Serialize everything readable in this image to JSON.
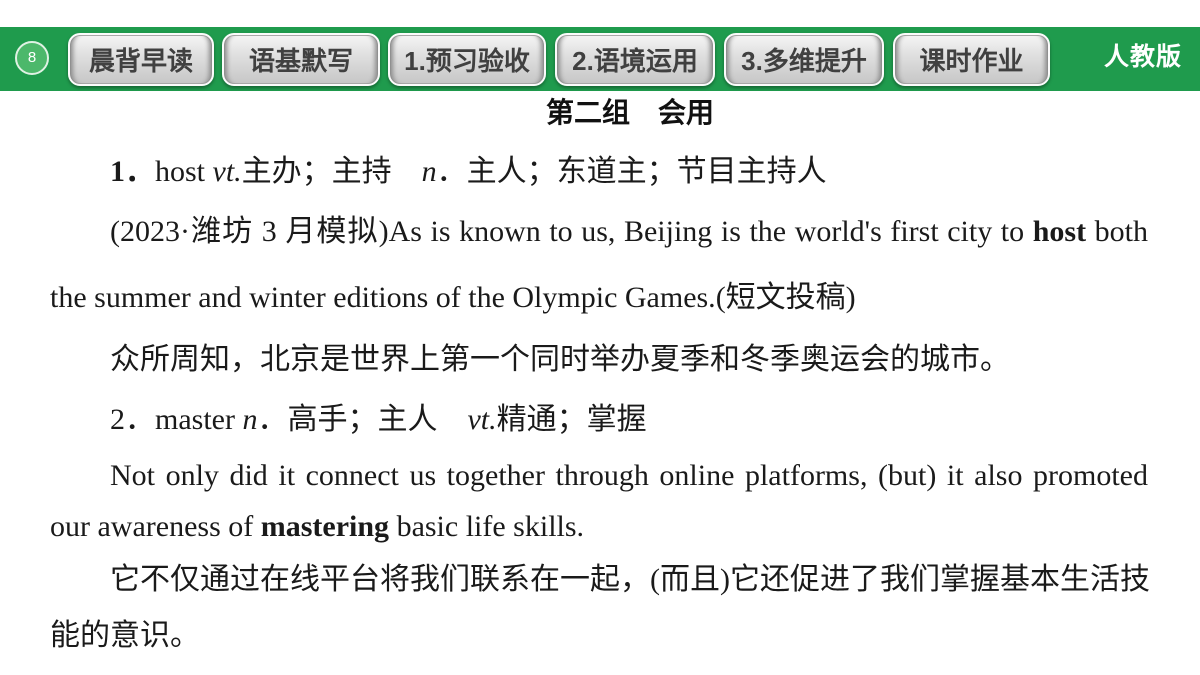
{
  "colors": {
    "header_green": "#1f9b4d",
    "badge_green": "#4cb86b",
    "tab_text": "#404040",
    "text": "#1a1a1a"
  },
  "header": {
    "page_number": "8",
    "tabs": [
      {
        "label": "晨背早读"
      },
      {
        "label": "语基默写"
      },
      {
        "label": "1.预习验收"
      },
      {
        "label": "2.语境运用"
      },
      {
        "label": "3.多维提升"
      },
      {
        "label": "课时作业"
      }
    ],
    "publisher": "人教版"
  },
  "content": {
    "group_title": "第二组　会用",
    "entries": [
      {
        "number": "1．",
        "headword": "host",
        "pos1": "vt.",
        "def1": "主办；主持　",
        "pos2": "n",
        "def2": "．主人；东道主；节目主持人",
        "example": {
          "source": "(2023·潍坊 3 月模拟)",
          "before": "As is known to us, Beijing is the world's first city to",
          "keyword": "host",
          "after_line1": "both",
          "after_line2": "the summer and winter editions of the Olympic Games.",
          "note": "(短文投稿)"
        },
        "translation": [
          "众所周知，北京是世界上第一个同时举办夏季和冬季奥运会的城市。"
        ]
      },
      {
        "number": "2．",
        "headword": "master",
        "pos1": "n",
        "def1": "．高手；主人　",
        "pos2": "vt.",
        "def2": "精通；掌握",
        "example": {
          "line1": "Not only did it connect us together through online platforms, (but) it also promoted",
          "before": "our awareness of",
          "keyword": "mastering",
          "after": "basic life skills."
        },
        "translation": [
          "它不仅通过在线平台将我们联系在一起，(而且)它还促进了我们掌握基本生活技",
          "能的意识。"
        ]
      }
    ]
  }
}
